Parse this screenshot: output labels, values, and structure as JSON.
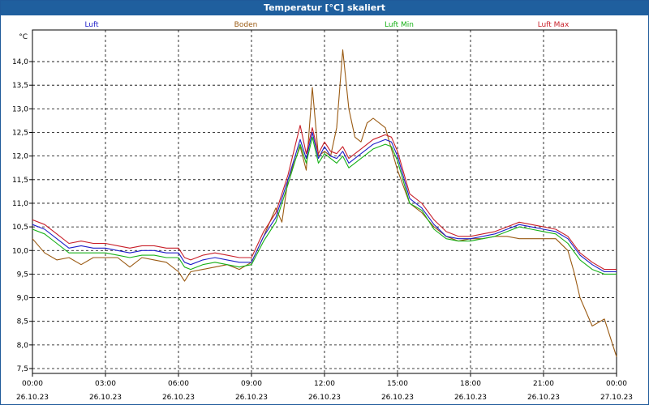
{
  "window": {
    "title": "Temperatur [°C] skaliert"
  },
  "colors": {
    "luft": "#1e1ec8",
    "boden": "#9a5a12",
    "luft_min": "#16b016",
    "luft_max": "#c81e28"
  },
  "chart_data": {
    "type": "line",
    "title": "Temperatur [°C] skaliert",
    "ylabel": "°C",
    "ylim": [
      7.5,
      14.5
    ],
    "xlim": [
      0,
      24
    ],
    "grid": true,
    "legend_position": "top",
    "yticks": [
      "7,5",
      "8,0",
      "8,5",
      "9,0",
      "9,5",
      "10,0",
      "10,5",
      "11,0",
      "11,5",
      "12,0",
      "12,5",
      "13,0",
      "13,5",
      "14,0"
    ],
    "xticks": [
      {
        "time": "00:00",
        "date": "26.10.23"
      },
      {
        "time": "03:00",
        "date": "26.10.23"
      },
      {
        "time": "06:00",
        "date": "26.10.23"
      },
      {
        "time": "09:00",
        "date": "26.10.23"
      },
      {
        "time": "12:00",
        "date": "26.10.23"
      },
      {
        "time": "15:00",
        "date": "26.10.23"
      },
      {
        "time": "18:00",
        "date": "26.10.23"
      },
      {
        "time": "21:00",
        "date": "26.10.23"
      },
      {
        "time": "00:00",
        "date": "27.10.23"
      }
    ],
    "series": [
      {
        "name": "Luft",
        "color": "#1e1ec8",
        "x": [
          0,
          0.5,
          1,
          1.5,
          2,
          2.5,
          3,
          3.5,
          4,
          4.5,
          5,
          5.5,
          6,
          6.25,
          6.5,
          7,
          7.5,
          8,
          8.5,
          9,
          9.5,
          10,
          10.5,
          11,
          11.25,
          11.5,
          11.75,
          12,
          12.25,
          12.5,
          12.75,
          13,
          13.5,
          14,
          14.5,
          14.75,
          15,
          15.5,
          16,
          16.5,
          17,
          17.5,
          18,
          18.5,
          19,
          19.5,
          20,
          20.5,
          21,
          21.5,
          22,
          22.5,
          23,
          23.5,
          24
        ],
        "y": [
          10.55,
          10.45,
          10.25,
          10.05,
          10.1,
          10.05,
          10.05,
          10.0,
          9.95,
          10.0,
          10.0,
          9.95,
          9.95,
          9.75,
          9.7,
          9.8,
          9.85,
          9.8,
          9.75,
          9.75,
          10.3,
          10.7,
          11.5,
          12.35,
          11.95,
          12.5,
          11.95,
          12.2,
          12.0,
          11.95,
          12.1,
          11.85,
          12.05,
          12.25,
          12.35,
          12.3,
          12.0,
          11.1,
          10.9,
          10.55,
          10.3,
          10.25,
          10.25,
          10.3,
          10.35,
          10.45,
          10.55,
          10.5,
          10.45,
          10.4,
          10.25,
          9.9,
          9.7,
          9.55,
          9.55
        ]
      },
      {
        "name": "Boden",
        "color": "#9a5a12",
        "x": [
          0,
          0.5,
          1,
          1.5,
          2,
          2.5,
          3,
          3.5,
          4,
          4.5,
          5,
          5.5,
          6,
          6.25,
          6.5,
          7,
          7.5,
          8,
          8.5,
          9,
          9.5,
          10,
          10.25,
          10.5,
          11,
          11.25,
          11.5,
          11.75,
          12,
          12.25,
          12.5,
          12.75,
          13,
          13.25,
          13.5,
          13.75,
          14,
          14.5,
          15,
          15.5,
          16,
          16.5,
          17,
          17.5,
          18,
          18.5,
          19,
          19.5,
          20,
          20.5,
          21,
          21.5,
          22,
          22.25,
          22.5,
          23,
          23.5,
          24
        ],
        "y": [
          10.25,
          9.95,
          9.8,
          9.85,
          9.7,
          9.85,
          9.85,
          9.85,
          9.65,
          9.85,
          9.8,
          9.75,
          9.55,
          9.35,
          9.55,
          9.6,
          9.65,
          9.7,
          9.6,
          9.75,
          10.3,
          10.9,
          10.6,
          11.5,
          12.2,
          11.7,
          13.45,
          12.0,
          12.1,
          12.0,
          12.6,
          14.25,
          13.0,
          12.4,
          12.3,
          12.7,
          12.8,
          12.6,
          11.7,
          11.0,
          10.8,
          10.5,
          10.3,
          10.2,
          10.25,
          10.25,
          10.3,
          10.3,
          10.25,
          10.25,
          10.25,
          10.25,
          10.0,
          9.55,
          9.0,
          8.4,
          8.55,
          7.75
        ]
      },
      {
        "name": "Luft Min",
        "color": "#16b016",
        "x": [
          0,
          0.5,
          1,
          1.5,
          2,
          2.5,
          3,
          3.5,
          4,
          4.5,
          5,
          5.5,
          6,
          6.25,
          6.5,
          7,
          7.5,
          8,
          8.5,
          9,
          9.5,
          10,
          10.5,
          11,
          11.25,
          11.5,
          11.75,
          12,
          12.25,
          12.5,
          12.75,
          13,
          13.5,
          14,
          14.5,
          14.75,
          15,
          15.5,
          16,
          16.5,
          17,
          17.5,
          18,
          18.5,
          19,
          19.5,
          20,
          20.5,
          21,
          21.5,
          22,
          22.5,
          23,
          23.5,
          24
        ],
        "y": [
          10.45,
          10.35,
          10.15,
          9.95,
          9.95,
          9.95,
          9.95,
          9.9,
          9.85,
          9.9,
          9.9,
          9.85,
          9.85,
          9.65,
          9.6,
          9.7,
          9.75,
          9.7,
          9.65,
          9.7,
          10.2,
          10.6,
          11.4,
          12.25,
          11.85,
          12.4,
          11.85,
          12.05,
          11.95,
          11.85,
          12.0,
          11.75,
          11.95,
          12.15,
          12.25,
          12.2,
          11.9,
          11.0,
          10.85,
          10.45,
          10.25,
          10.2,
          10.2,
          10.25,
          10.3,
          10.4,
          10.5,
          10.45,
          10.4,
          10.35,
          10.15,
          9.8,
          9.6,
          9.5,
          9.5
        ]
      },
      {
        "name": "Luft Max",
        "color": "#c81e28",
        "x": [
          0,
          0.5,
          1,
          1.5,
          2,
          2.5,
          3,
          3.5,
          4,
          4.5,
          5,
          5.5,
          6,
          6.25,
          6.5,
          7,
          7.5,
          8,
          8.5,
          9,
          9.5,
          10,
          10.5,
          11,
          11.25,
          11.5,
          11.75,
          12,
          12.25,
          12.5,
          12.75,
          13,
          13.5,
          14,
          14.5,
          14.75,
          15,
          15.5,
          16,
          16.5,
          17,
          17.5,
          18,
          18.5,
          19,
          19.5,
          20,
          20.5,
          21,
          21.5,
          22,
          22.5,
          23,
          23.5,
          24
        ],
        "y": [
          10.65,
          10.55,
          10.35,
          10.15,
          10.2,
          10.15,
          10.15,
          10.1,
          10.05,
          10.1,
          10.1,
          10.05,
          10.05,
          9.85,
          9.8,
          9.9,
          9.95,
          9.9,
          9.85,
          9.85,
          10.4,
          10.8,
          11.6,
          12.65,
          12.05,
          12.6,
          12.05,
          12.3,
          12.1,
          12.05,
          12.2,
          11.95,
          12.15,
          12.35,
          12.45,
          12.4,
          12.1,
          11.2,
          11.0,
          10.65,
          10.4,
          10.3,
          10.3,
          10.35,
          10.4,
          10.5,
          10.6,
          10.55,
          10.5,
          10.45,
          10.3,
          9.95,
          9.75,
          9.6,
          9.6
        ]
      }
    ]
  }
}
